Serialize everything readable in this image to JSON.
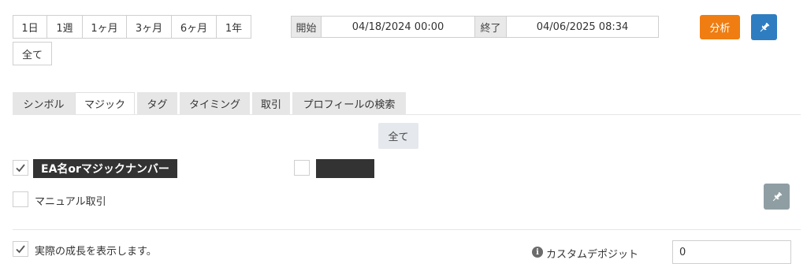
{
  "periods": [
    "1日",
    "1週",
    "1ヶ月",
    "3ヶ月",
    "6ヶ月",
    "1年",
    "全て"
  ],
  "date_range": {
    "start_label": "開始",
    "start_value": "04/18/2024 00:00",
    "end_label": "終了",
    "end_value": "04/06/2025 08:34"
  },
  "toolbar": {
    "analyze_label": "分析",
    "pin_icon": "pin-icon"
  },
  "tabs": [
    "シンボル",
    "マジック",
    "タグ",
    "タイミング",
    "取引",
    "プロフィールの検索"
  ],
  "active_tab": "マジック",
  "magic": {
    "select_all_label": "全て",
    "ea_label": "EA名orマジックナンバー",
    "manual_label": "マニュアル取引"
  },
  "footer": {
    "real_growth_label": "実際の成長を表示します。",
    "custom_deposit_label": "カスタムデポジット",
    "custom_deposit_value": "0"
  },
  "colors": {
    "accent_orange": "#ef7d12",
    "pin_blue": "#2f7dc1",
    "pin_grey": "#8f9ea3"
  }
}
